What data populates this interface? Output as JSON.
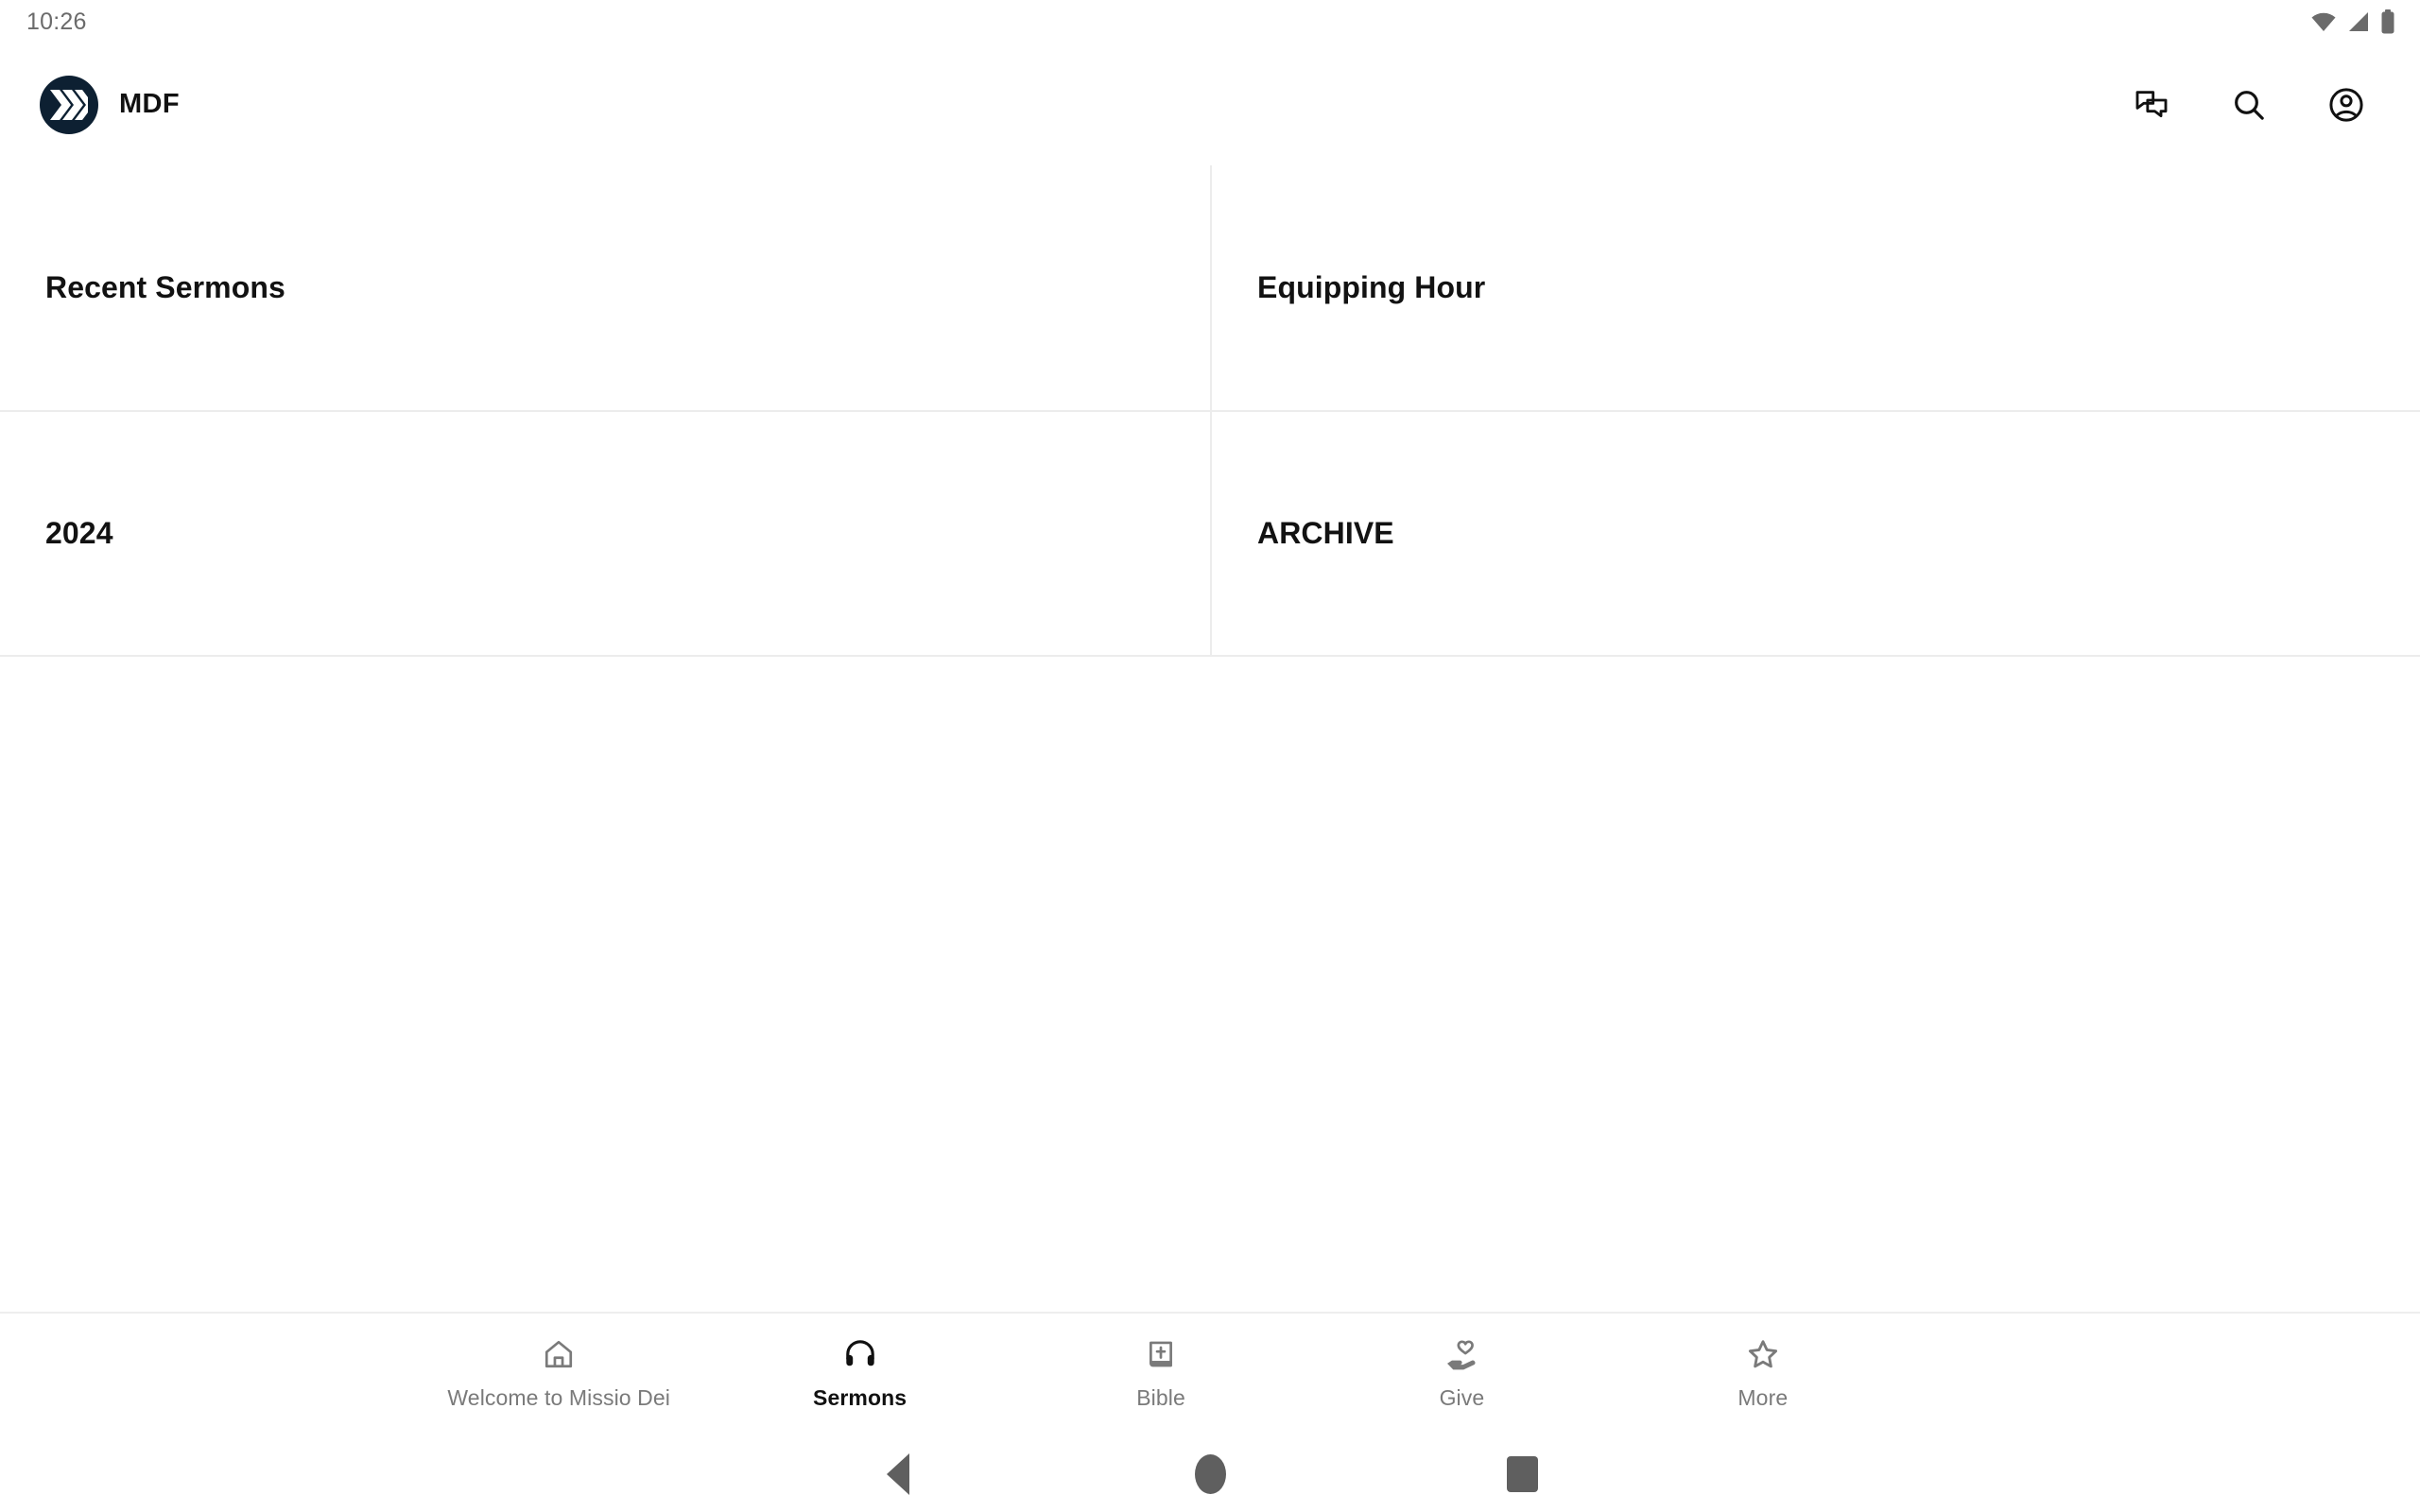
{
  "status_bar": {
    "time": "10:26",
    "icons": [
      "wifi-icon",
      "cell-signal-icon",
      "battery-icon"
    ]
  },
  "header": {
    "logo_icon": "mdf-chevrons-logo-icon",
    "brand_name": "MDF",
    "brand_color": "#0d2032",
    "actions": [
      {
        "name": "messages-icon",
        "label": "Messages"
      },
      {
        "name": "search-icon",
        "label": "Search"
      },
      {
        "name": "account-circle-icon",
        "label": "Account"
      }
    ]
  },
  "main": {
    "tiles": [
      {
        "title": "Recent Sermons"
      },
      {
        "title": "Equipping Hour"
      },
      {
        "title": "2024"
      },
      {
        "title": "ARCHIVE"
      }
    ]
  },
  "bottom_nav": {
    "items": [
      {
        "label": "Welcome to Missio Dei",
        "icon": "home-icon",
        "active": false
      },
      {
        "label": "Sermons",
        "icon": "headphones-icon",
        "active": true
      },
      {
        "label": "Bible",
        "icon": "bible-book-icon",
        "active": false
      },
      {
        "label": "Give",
        "icon": "hand-heart-icon",
        "active": false
      },
      {
        "label": "More",
        "icon": "star-icon",
        "active": false
      }
    ],
    "active_color": "#111111",
    "inactive_color": "#7a7a7a"
  },
  "system_nav": {
    "buttons": [
      {
        "name": "android-back-button",
        "label": "Back"
      },
      {
        "name": "android-home-button",
        "label": "Home"
      },
      {
        "name": "android-recents-button",
        "label": "Recents"
      }
    ]
  }
}
